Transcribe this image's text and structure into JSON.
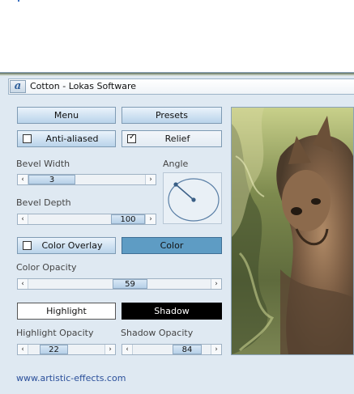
{
  "window": {
    "title": "Cotton - Lokas Software",
    "logo_glyph": "a"
  },
  "buttons": {
    "menu": "Menu",
    "presets": "Presets",
    "anti_aliased": "Anti-aliased",
    "relief": "Relief",
    "color_overlay": "Color Overlay",
    "color": "Color",
    "highlight": "Highlight",
    "shadow": "Shadow"
  },
  "checks": {
    "anti_aliased": false,
    "relief": true,
    "color_overlay": false
  },
  "sliders": {
    "bevel_width": {
      "label": "Bevel Width",
      "value": "3"
    },
    "bevel_depth": {
      "label": "Bevel Depth",
      "value": "100"
    },
    "color_opacity": {
      "label": "Color Opacity",
      "value": "59"
    },
    "highlight_opacity": {
      "label": "Highlight Opacity",
      "value": "22"
    },
    "shadow_opacity": {
      "label": "Shadow Opacity",
      "value": "84"
    }
  },
  "angle": {
    "label": "Angle"
  },
  "footer": {
    "link": "www.artistic-effects.com"
  },
  "colors": {
    "color_swatch": "#5e9cc4",
    "highlight": "#ffffff",
    "shadow": "#000000",
    "panel": "#dfe9f2"
  },
  "icons": {
    "arrow_left": "‹",
    "arrow_right": "›",
    "check_mark": "✓"
  }
}
